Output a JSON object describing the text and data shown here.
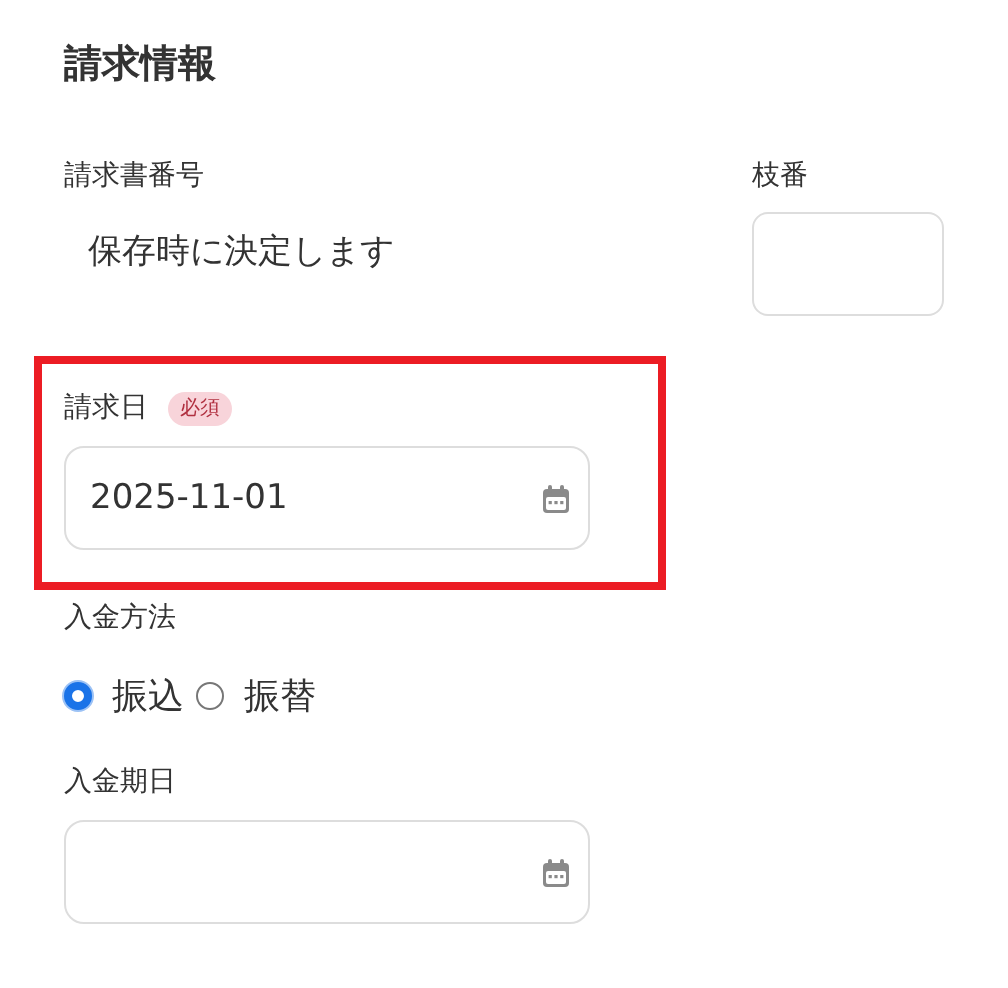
{
  "section_title": "請求情報",
  "invoice_number": {
    "label": "請求書番号",
    "value": "保存時に決定します"
  },
  "branch_number": {
    "label": "枝番"
  },
  "invoice_date": {
    "label": "請求日",
    "badge": "必須",
    "value": "2025-11-01",
    "highlighted": true
  },
  "payment_method": {
    "label": "入金方法",
    "options": [
      {
        "label": "振込",
        "selected": true
      },
      {
        "label": "振替",
        "selected": false
      }
    ]
  },
  "payment_due_date": {
    "label": "入金期日"
  }
}
